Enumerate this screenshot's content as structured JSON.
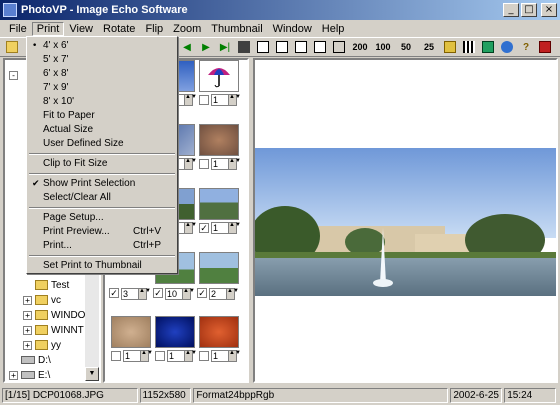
{
  "window": {
    "title": "PhotoVP - Image Echo Software"
  },
  "menu": [
    {
      "label": "File"
    },
    {
      "label": "Print",
      "active": true
    },
    {
      "label": "View"
    },
    {
      "label": "Rotate"
    },
    {
      "label": "Flip"
    },
    {
      "label": "Zoom"
    },
    {
      "label": "Thumbnail"
    },
    {
      "label": "Window"
    },
    {
      "label": "Help"
    }
  ],
  "toolbar": {
    "zoom_buttons": [
      "200",
      "100",
      "50",
      "25"
    ]
  },
  "print_menu": {
    "items": [
      {
        "label": "4' x 6'",
        "mark": "•"
      },
      {
        "label": "5' x 7'"
      },
      {
        "label": "6' x 8'"
      },
      {
        "label": "7' x 9'"
      },
      {
        "label": "8' x 10'"
      },
      {
        "label": "Fit to Paper"
      },
      {
        "label": "Actual Size"
      },
      {
        "label": "User Defined Size"
      },
      {
        "label": "Clip to Fit Size"
      },
      {
        "label": "Show Print Selection",
        "mark": "✔"
      },
      {
        "label": "Select/Clear All"
      },
      {
        "label": "Page Setup..."
      },
      {
        "label": "Print Preview...",
        "shortcut": "Ctrl+V"
      },
      {
        "label": "Print...",
        "shortcut": "Ctrl+P"
      },
      {
        "label": "Set Print to Thumbnail"
      }
    ]
  },
  "tree": {
    "items": [
      {
        "label": "Test",
        "kind": "folder"
      },
      {
        "label": "vc",
        "kind": "folder",
        "expander": "+"
      },
      {
        "label": "WINDOWS",
        "kind": "folder",
        "expander": "+"
      },
      {
        "label": "WINNT",
        "kind": "folder",
        "expander": "+"
      },
      {
        "label": "yy",
        "kind": "folder",
        "expander": "+"
      },
      {
        "label": "D:\\",
        "kind": "drive"
      },
      {
        "label": "E:\\",
        "kind": "drive",
        "expander": "+"
      }
    ]
  },
  "thumbnails": {
    "counts": [
      "1",
      "1",
      "1",
      "1",
      "1",
      "1",
      "1",
      "1",
      "3",
      "10",
      "2",
      "1",
      "1",
      "1"
    ],
    "checked": [
      false,
      false,
      false,
      false,
      false,
      false,
      false,
      true,
      true,
      true,
      true,
      false,
      false,
      false
    ]
  },
  "status": {
    "index": "[1/15]",
    "filename": "DCP01068.JPG",
    "dimensions": "1152x580",
    "format": "Format24bppRgb",
    "date": "2002-6-25",
    "time": "15:24"
  },
  "colors": {
    "titlebar_start": "#0a246a",
    "titlebar_end": "#a6caf0",
    "face": "#d4d0c8"
  }
}
